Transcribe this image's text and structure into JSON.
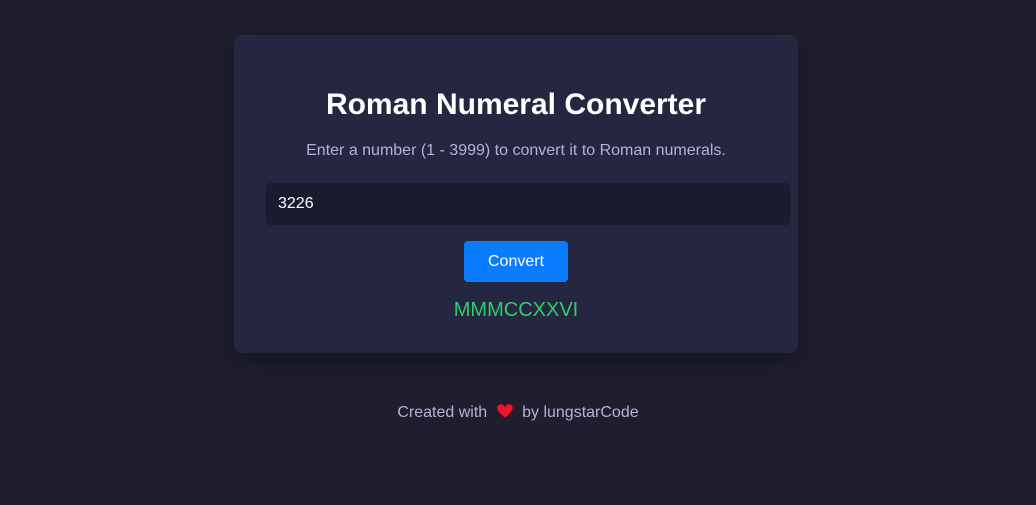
{
  "converter": {
    "title": "Roman Numeral Converter",
    "subtitle": "Enter a number (1 - 3999) to convert it to Roman numerals.",
    "input_value": "3226",
    "button_label": "Convert",
    "result": "MMMCCXXVI"
  },
  "footer": {
    "prefix": "Created with",
    "icon": "heart-icon",
    "suffix": "by lungstarCode"
  },
  "colors": {
    "background": "#1e1e2e",
    "card": "#252640",
    "input": "#1a1b2e",
    "accent": "#0a7cff",
    "result": "#2ecc71",
    "heart": "#e8192c"
  }
}
